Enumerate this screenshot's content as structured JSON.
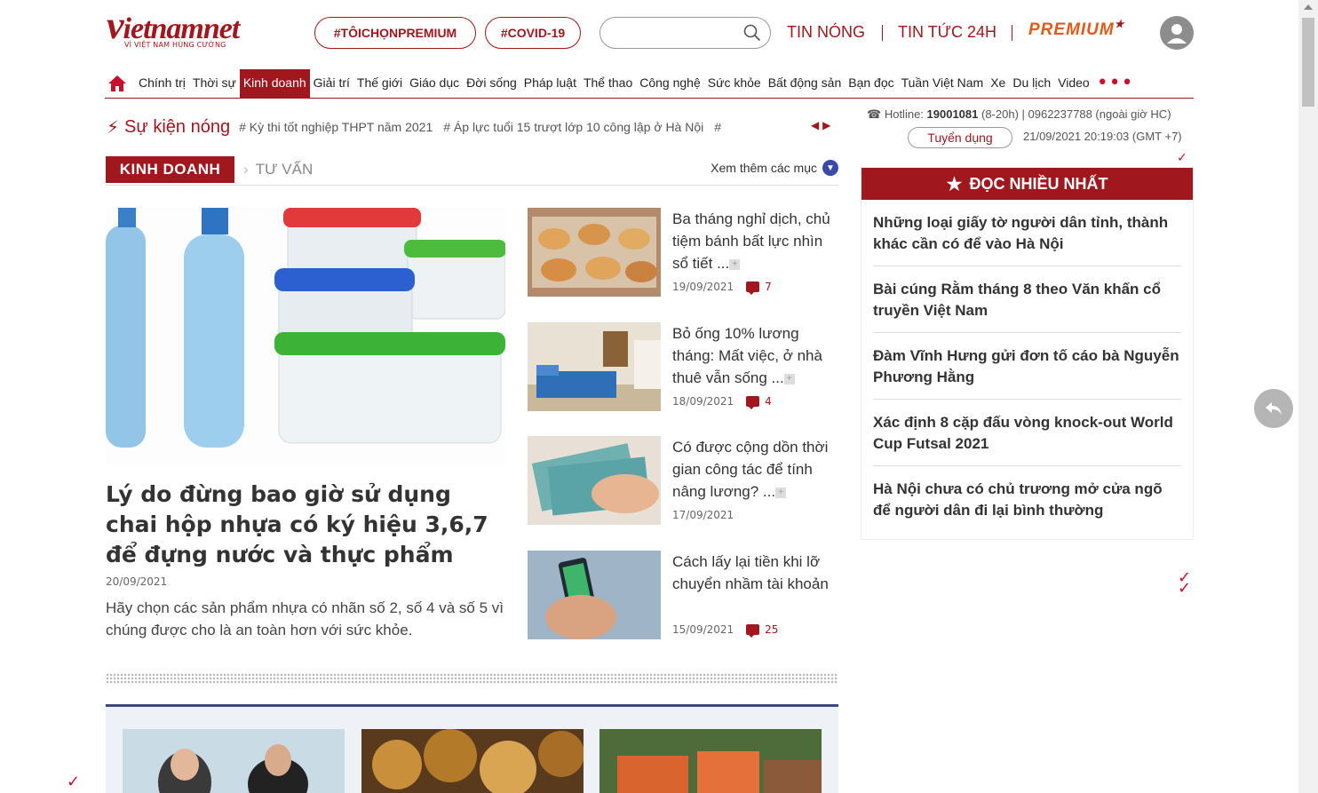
{
  "header": {
    "logo_text": "vietnamnet",
    "logo_tagline": "VÌ VIỆT NAM HÙNG CƯỜNG",
    "pill_premium": "#TÔICHỌNPREMIUM",
    "pill_covid": "#COVID-19",
    "search": {
      "value": "",
      "placeholder": ""
    },
    "tin_nong": "TIN NÓNG",
    "tin_tuc_24h": "TIN TỨC 24H",
    "premium": "PREMIUM"
  },
  "nav": {
    "items": [
      "Chính trị",
      "Thời sự",
      "Kinh doanh",
      "Giải trí",
      "Thế giới",
      "Giáo dục",
      "Đời sống",
      "Pháp luật",
      "Thể thao",
      "Công nghệ",
      "Sức khỏe",
      "Bất động sản",
      "Bạn đọc",
      "Tuần Việt Nam",
      "Xe",
      "Du lịch",
      "Video"
    ],
    "active": "Kinh doanh",
    "more": "•••"
  },
  "hot_events": {
    "label": "Sự kiện nóng",
    "tags": [
      "# Kỳ thi tốt nghiệp THPT năm 2021",
      "# Áp lực tuổi 15 trượt lớp 10 công lập ở Hà Nội",
      "#"
    ]
  },
  "contact": {
    "hotline_label": "Hotline:",
    "hotline_number": "19001081",
    "hotline_rest": "(8-20h) | 0962237788 (ngoài giờ HC)",
    "recruit": "Tuyển dụng",
    "datetime": "21/09/2021 20:19:03 (GMT +7)"
  },
  "section": {
    "title": "KINH DOANH",
    "sub": "TƯ VẤN",
    "more": "Xem thêm các mục"
  },
  "lead": {
    "title": "Lý do đừng bao giờ sử dụng chai hộp nhựa có ký hiệu 3,6,7 để đựng nước và thực phẩm",
    "date": "20/09/2021",
    "summary": "Hãy chọn các sản phẩm nhựa có nhãn số 2, số 4 và số 5 vì chúng được cho là an toàn hơn với sức khỏe."
  },
  "side_articles": [
    {
      "title": "Ba tháng nghỉ dịch, chủ tiệm bánh bất lực nhìn sổ tiết ...",
      "date": "19/09/2021",
      "comments": "7"
    },
    {
      "title": "Bỏ ống 10% lương tháng: Mất việc, ở nhà thuê vẫn sống ...",
      "date": "18/09/2021",
      "comments": "4"
    },
    {
      "title": "Có được cộng dồn thời gian công tác để tính nâng lương? ...",
      "date": "17/09/2021",
      "comments": ""
    },
    {
      "title": "Cách lấy lại tiền khi lỡ chuyển nhầm tài khoản",
      "date": "15/09/2021",
      "comments": "25"
    }
  ],
  "read_most": {
    "title": "ĐỌC NHIỀU NHẤT",
    "items": [
      "Những loại giấy tờ người dân tỉnh, thành khác cần có để vào Hà Nội",
      "Bài cúng Rằm tháng 8 theo Văn khấn cổ truyền Việt Nam",
      "Đàm Vĩnh Hưng gửi đơn tố cáo bà Nguyễn Phương Hằng",
      "Xác định 8 cặp đấu vòng knock-out World Cup Futsal 2021",
      "Hà Nội chưa có chủ trương mở cửa ngõ để người dân đi lại bình thường"
    ]
  },
  "colors": {
    "brand": "#a0171e",
    "accent_blue": "#3a4aa8"
  }
}
